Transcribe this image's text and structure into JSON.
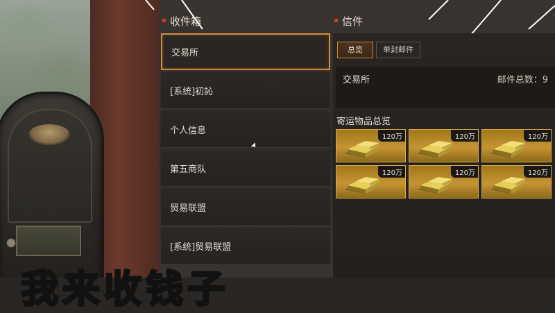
{
  "inbox": {
    "title": "收件箱",
    "items": [
      {
        "label": "交易所",
        "selected": true
      },
      {
        "label": "[系统]初訫",
        "selected": false
      },
      {
        "label": "个人信息",
        "selected": false
      },
      {
        "label": "第五商队",
        "selected": false
      },
      {
        "label": "贸易联盟",
        "selected": false
      },
      {
        "label": "[系统]贸易联盟",
        "selected": false
      }
    ]
  },
  "letter": {
    "title": "信件",
    "tabs": [
      {
        "label": "总览",
        "active": true
      },
      {
        "label": "单封邮件",
        "active": false
      }
    ],
    "sender": "交易所",
    "mail_count_label": "邮件总数：9",
    "section_title": "寄运物品总览",
    "items": [
      {
        "icon": "gold-bar-icon",
        "quantity": "120万"
      },
      {
        "icon": "gold-bar-icon",
        "quantity": "120万"
      },
      {
        "icon": "gold-bar-icon",
        "quantity": "120万"
      },
      {
        "icon": "gold-bar-icon",
        "quantity": "120万"
      },
      {
        "icon": "gold-bar-icon",
        "quantity": "120万"
      },
      {
        "icon": "gold-bar-icon",
        "quantity": "120万"
      }
    ]
  },
  "caption": "我来收钱子",
  "colors": {
    "accent": "#d88b3a",
    "marker": "#c8412d",
    "caption": "#f7e21a"
  }
}
